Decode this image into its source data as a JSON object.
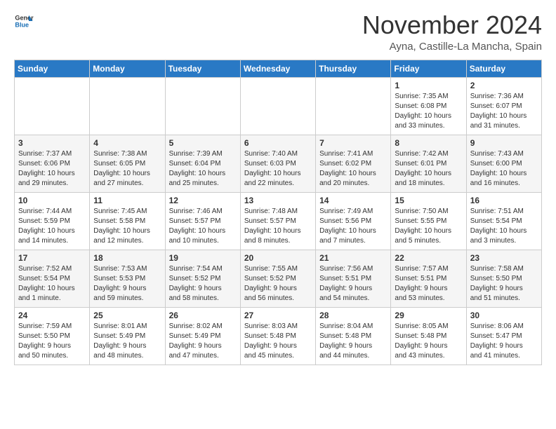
{
  "header": {
    "logo": {
      "line1": "General",
      "line2": "Blue"
    },
    "title": "November 2024",
    "subtitle": "Ayna, Castille-La Mancha, Spain"
  },
  "weekdays": [
    "Sunday",
    "Monday",
    "Tuesday",
    "Wednesday",
    "Thursday",
    "Friday",
    "Saturday"
  ],
  "weeks": [
    [
      {
        "day": "",
        "info": ""
      },
      {
        "day": "",
        "info": ""
      },
      {
        "day": "",
        "info": ""
      },
      {
        "day": "",
        "info": ""
      },
      {
        "day": "",
        "info": ""
      },
      {
        "day": "1",
        "info": "Sunrise: 7:35 AM\nSunset: 6:08 PM\nDaylight: 10 hours\nand 33 minutes."
      },
      {
        "day": "2",
        "info": "Sunrise: 7:36 AM\nSunset: 6:07 PM\nDaylight: 10 hours\nand 31 minutes."
      }
    ],
    [
      {
        "day": "3",
        "info": "Sunrise: 7:37 AM\nSunset: 6:06 PM\nDaylight: 10 hours\nand 29 minutes."
      },
      {
        "day": "4",
        "info": "Sunrise: 7:38 AM\nSunset: 6:05 PM\nDaylight: 10 hours\nand 27 minutes."
      },
      {
        "day": "5",
        "info": "Sunrise: 7:39 AM\nSunset: 6:04 PM\nDaylight: 10 hours\nand 25 minutes."
      },
      {
        "day": "6",
        "info": "Sunrise: 7:40 AM\nSunset: 6:03 PM\nDaylight: 10 hours\nand 22 minutes."
      },
      {
        "day": "7",
        "info": "Sunrise: 7:41 AM\nSunset: 6:02 PM\nDaylight: 10 hours\nand 20 minutes."
      },
      {
        "day": "8",
        "info": "Sunrise: 7:42 AM\nSunset: 6:01 PM\nDaylight: 10 hours\nand 18 minutes."
      },
      {
        "day": "9",
        "info": "Sunrise: 7:43 AM\nSunset: 6:00 PM\nDaylight: 10 hours\nand 16 minutes."
      }
    ],
    [
      {
        "day": "10",
        "info": "Sunrise: 7:44 AM\nSunset: 5:59 PM\nDaylight: 10 hours\nand 14 minutes."
      },
      {
        "day": "11",
        "info": "Sunrise: 7:45 AM\nSunset: 5:58 PM\nDaylight: 10 hours\nand 12 minutes."
      },
      {
        "day": "12",
        "info": "Sunrise: 7:46 AM\nSunset: 5:57 PM\nDaylight: 10 hours\nand 10 minutes."
      },
      {
        "day": "13",
        "info": "Sunrise: 7:48 AM\nSunset: 5:57 PM\nDaylight: 10 hours\nand 8 minutes."
      },
      {
        "day": "14",
        "info": "Sunrise: 7:49 AM\nSunset: 5:56 PM\nDaylight: 10 hours\nand 7 minutes."
      },
      {
        "day": "15",
        "info": "Sunrise: 7:50 AM\nSunset: 5:55 PM\nDaylight: 10 hours\nand 5 minutes."
      },
      {
        "day": "16",
        "info": "Sunrise: 7:51 AM\nSunset: 5:54 PM\nDaylight: 10 hours\nand 3 minutes."
      }
    ],
    [
      {
        "day": "17",
        "info": "Sunrise: 7:52 AM\nSunset: 5:54 PM\nDaylight: 10 hours\nand 1 minute."
      },
      {
        "day": "18",
        "info": "Sunrise: 7:53 AM\nSunset: 5:53 PM\nDaylight: 9 hours\nand 59 minutes."
      },
      {
        "day": "19",
        "info": "Sunrise: 7:54 AM\nSunset: 5:52 PM\nDaylight: 9 hours\nand 58 minutes."
      },
      {
        "day": "20",
        "info": "Sunrise: 7:55 AM\nSunset: 5:52 PM\nDaylight: 9 hours\nand 56 minutes."
      },
      {
        "day": "21",
        "info": "Sunrise: 7:56 AM\nSunset: 5:51 PM\nDaylight: 9 hours\nand 54 minutes."
      },
      {
        "day": "22",
        "info": "Sunrise: 7:57 AM\nSunset: 5:51 PM\nDaylight: 9 hours\nand 53 minutes."
      },
      {
        "day": "23",
        "info": "Sunrise: 7:58 AM\nSunset: 5:50 PM\nDaylight: 9 hours\nand 51 minutes."
      }
    ],
    [
      {
        "day": "24",
        "info": "Sunrise: 7:59 AM\nSunset: 5:50 PM\nDaylight: 9 hours\nand 50 minutes."
      },
      {
        "day": "25",
        "info": "Sunrise: 8:01 AM\nSunset: 5:49 PM\nDaylight: 9 hours\nand 48 minutes."
      },
      {
        "day": "26",
        "info": "Sunrise: 8:02 AM\nSunset: 5:49 PM\nDaylight: 9 hours\nand 47 minutes."
      },
      {
        "day": "27",
        "info": "Sunrise: 8:03 AM\nSunset: 5:48 PM\nDaylight: 9 hours\nand 45 minutes."
      },
      {
        "day": "28",
        "info": "Sunrise: 8:04 AM\nSunset: 5:48 PM\nDaylight: 9 hours\nand 44 minutes."
      },
      {
        "day": "29",
        "info": "Sunrise: 8:05 AM\nSunset: 5:48 PM\nDaylight: 9 hours\nand 43 minutes."
      },
      {
        "day": "30",
        "info": "Sunrise: 8:06 AM\nSunset: 5:47 PM\nDaylight: 9 hours\nand 41 minutes."
      }
    ]
  ]
}
